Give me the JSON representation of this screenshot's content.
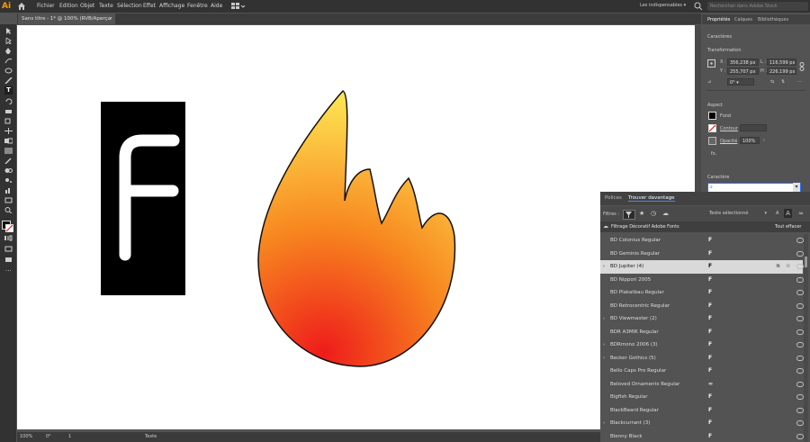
{
  "app": {
    "logo": "Ai"
  },
  "menubar": {
    "items": [
      "Fichier",
      "Edition",
      "Objet",
      "Texte",
      "Sélection",
      "Effet",
      "Affichage",
      "Fenêtre",
      "Aide"
    ],
    "workspace": "Les indispensables",
    "stock_search_placeholder": "Rechercher dans Adobe Stock"
  },
  "document": {
    "tab_title": "Sans titre - 1* @ 100% (RVB/Aperçu GPU)"
  },
  "statusbar": {
    "zoom": "100%",
    "rotation": "0°",
    "artboard": "1",
    "tool": "Texte"
  },
  "properties": {
    "tabs": [
      "Propriétés",
      "Calques",
      "Bibliothèques"
    ],
    "section_title": "Caractères",
    "transform_label": "Transformation",
    "x_label": "X :",
    "x_value": "356,238 px",
    "y_label": "Y :",
    "y_value": "255,707 px",
    "w_label": "L :",
    "w_value": "116,599 px",
    "h_label": "H :",
    "h_value": "226,199 px",
    "angle_value": "0°",
    "aspect_label": "Aspect",
    "fill_label": "Fond",
    "stroke_label": "Contour",
    "opacity_label": "Opacité",
    "opacity_value": "100%",
    "fx_label": "fx.",
    "character_label": "Caractère"
  },
  "font_panel": {
    "tabs": [
      "Polices",
      "Trouver davantage"
    ],
    "active_tab": 1,
    "filters_label": "Filtres :",
    "sample_mode": "Texte sélectionné",
    "filter_info": "Filtrage Décoratif Adobe Fonts",
    "clear_all": "Tout effacer",
    "fonts": [
      {
        "name": "BD Colonius Regular",
        "expandable": false,
        "sample": "F"
      },
      {
        "name": "BD Geminis Regular",
        "expandable": false,
        "sample": "F"
      },
      {
        "name": "BD Jupiter (4)",
        "expandable": true,
        "sample": "F",
        "selected": true
      },
      {
        "name": "BD Nippori 2005",
        "expandable": false,
        "sample": "F"
      },
      {
        "name": "BD Plakatbau Regular",
        "expandable": false,
        "sample": "F"
      },
      {
        "name": "BD Retrocentric Regular",
        "expandable": false,
        "sample": "F"
      },
      {
        "name": "BD Viewmaster (2)",
        "expandable": true,
        "sample": "F"
      },
      {
        "name": "BDR A3MIK Regular",
        "expandable": false,
        "sample": "F"
      },
      {
        "name": "BDRmono 2006 (3)",
        "expandable": true,
        "sample": "F"
      },
      {
        "name": "Becker Gothics (5)",
        "expandable": true,
        "sample": "F"
      },
      {
        "name": "Bello Caps Pro Regular",
        "expandable": false,
        "sample": "F"
      },
      {
        "name": "Beloved Ornaments Regular",
        "expandable": false,
        "sample": "∞"
      },
      {
        "name": "Bigfish Regular",
        "expandable": false,
        "sample": "F"
      },
      {
        "name": "BlackBeard Regular",
        "expandable": false,
        "sample": "F"
      },
      {
        "name": "Blackcurrant (3)",
        "expandable": true,
        "sample": "F"
      },
      {
        "name": "Blenny Black",
        "expandable": false,
        "sample": "F"
      }
    ]
  },
  "artwork": {
    "letter": "F"
  },
  "colors": {
    "accent": "#ff9a00",
    "flame_top": "#fff35a",
    "flame_bottom": "#ee1b1b"
  }
}
